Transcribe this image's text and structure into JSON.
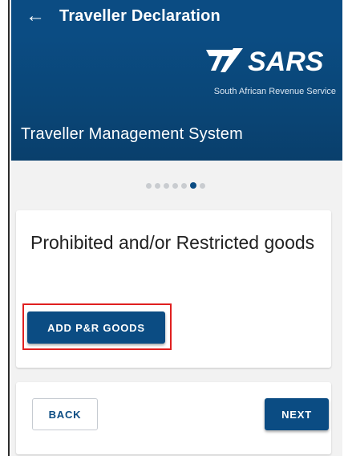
{
  "header": {
    "back_icon": "arrow-left-icon",
    "back_glyph": "←",
    "title": "Traveller Declaration"
  },
  "banner": {
    "logo_text": "SARS",
    "tagline": "South African Revenue Service",
    "heading": "Traveller Management System"
  },
  "pager": {
    "total": 7,
    "active_index": 5
  },
  "section": {
    "title": "Prohibited and/or Restricted goods",
    "add_button_label": "ADD P&R GOODS"
  },
  "nav": {
    "back_label": "BACK",
    "next_label": "NEXT"
  },
  "colors": {
    "brand_blue": "#0b4c83",
    "highlight_red": "#e02020",
    "background": "#f2f2f2"
  }
}
